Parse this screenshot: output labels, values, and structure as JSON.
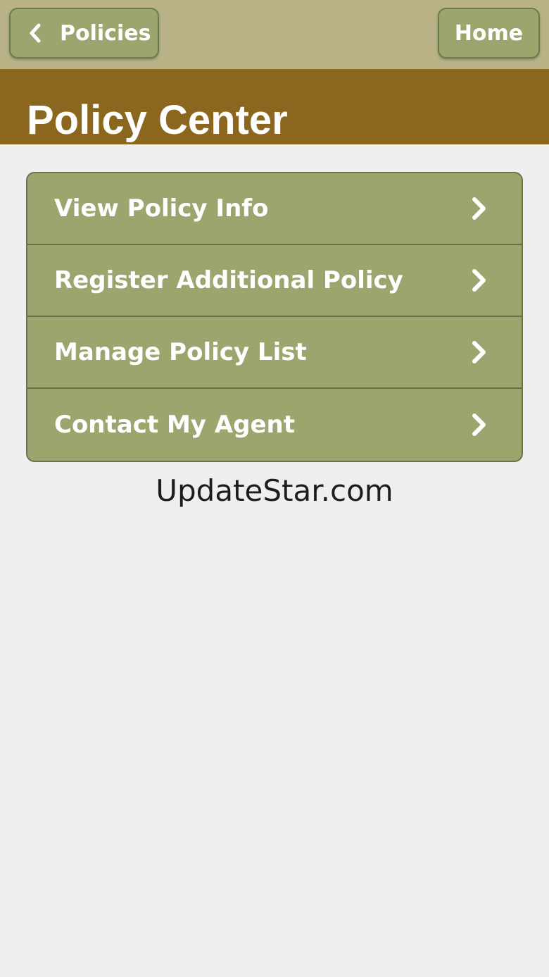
{
  "top_bar": {
    "back_label": "Policies",
    "home_label": "Home",
    "back_icon": "chevron-left-icon"
  },
  "header": {
    "title": "Policy Center"
  },
  "menu": {
    "items": [
      {
        "label": "View Policy Info",
        "icon": "chevron-right-icon"
      },
      {
        "label": "Register Additional Policy",
        "icon": "chevron-right-icon"
      },
      {
        "label": "Manage Policy List",
        "icon": "chevron-right-icon"
      },
      {
        "label": "Contact My Agent",
        "icon": "chevron-right-icon"
      }
    ]
  },
  "footer": {
    "watermark": "UpdateStar.com"
  },
  "colors": {
    "top_bar_bg": "#b9b287",
    "header_bg": "#8b661e",
    "button_bg": "#9ba56d",
    "page_bg": "#efefef"
  }
}
